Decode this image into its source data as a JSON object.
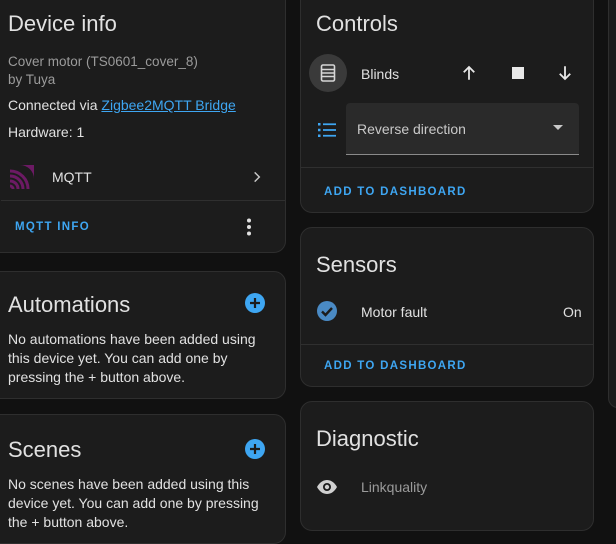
{
  "colors": {
    "accent": "#3ea6f2",
    "background": "#111111",
    "card": "#1c1c1c",
    "mqtt_logo": "#6c1a64"
  },
  "device_info": {
    "title": "Device info",
    "model": "Cover motor (TS0601_cover_8)",
    "manufacturer": "by Tuya",
    "connected_prefix": "Connected via ",
    "connected_link": "Zigbee2MQTT Bridge",
    "hardware": "Hardware: 1",
    "integration_label": "MQTT",
    "integration_icon": "mqtt-logo-icon",
    "mqtt_info_label": "MQTT INFO"
  },
  "automations": {
    "title": "Automations",
    "text": "No automations have been added using this device yet. You can add one by pressing the + button above."
  },
  "scenes": {
    "title": "Scenes",
    "text": "No scenes have been added using this device yet. You can add one by pressing the + button above."
  },
  "controls": {
    "title": "Controls",
    "blinds_label": "Blinds",
    "select_label": "Reverse direction",
    "add_label": "ADD TO DASHBOARD"
  },
  "sensors": {
    "title": "Sensors",
    "motor_fault_label": "Motor fault",
    "motor_fault_value": "On",
    "add_label": "ADD TO DASHBOARD"
  },
  "diagnostic": {
    "title": "Diagnostic",
    "linkquality_label": "Linkquality"
  }
}
